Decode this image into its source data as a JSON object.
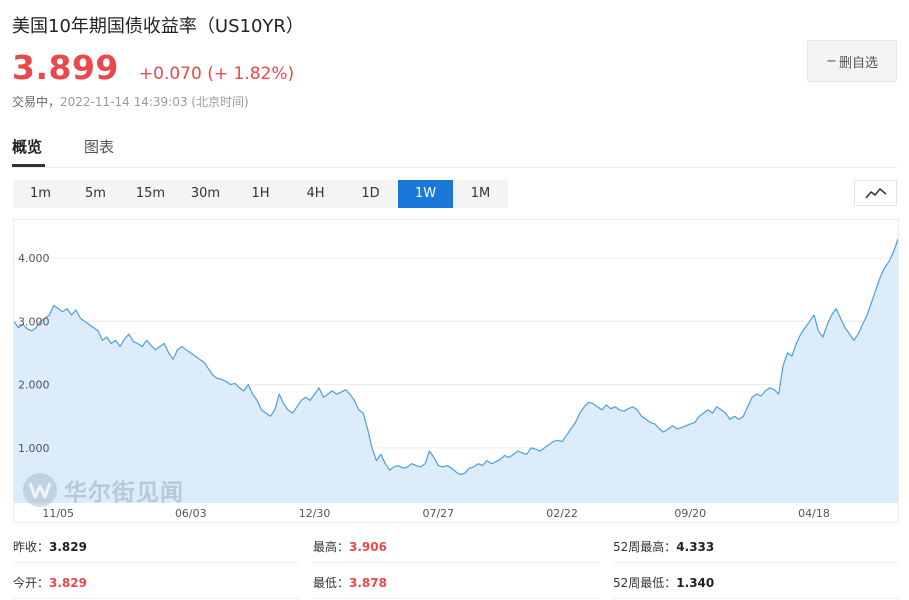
{
  "header": {
    "title": "美国10年期国债收益率（US10YR）",
    "price": "3.899",
    "change": "+0.070 (+ 1.82%)",
    "status_label": "交易中，",
    "timestamp": "2022-11-14 14:39:03",
    "timezone": "(北京时间)",
    "remove_button": "删自选",
    "remove_button_prefix": "−"
  },
  "tabs": [
    {
      "label": "概览",
      "active": true
    },
    {
      "label": "图表",
      "active": false
    }
  ],
  "periods": [
    {
      "label": "1m"
    },
    {
      "label": "5m"
    },
    {
      "label": "15m"
    },
    {
      "label": "30m"
    },
    {
      "label": "1H"
    },
    {
      "label": "4H"
    },
    {
      "label": "1D"
    },
    {
      "label": "1W",
      "active": true
    },
    {
      "label": "1M"
    }
  ],
  "watermark": {
    "text": "华尔街见闻",
    "logo_letter": "W"
  },
  "stats": {
    "prev_close_label": "昨收：",
    "prev_close": "3.829",
    "high_label": "最高：",
    "high": "3.906",
    "wk52_high_label": "52周最高：",
    "wk52_high": "4.333",
    "open_label": "今开：",
    "open": "3.829",
    "low_label": "最低：",
    "low": "3.878",
    "wk52_low_label": "52周最低：",
    "wk52_low": "1.340"
  },
  "colors": {
    "up": "#e9494b",
    "accent": "#1a78d8",
    "line": "#4d9fe0",
    "fill": "#dcecfb"
  },
  "chart_data": {
    "type": "area",
    "title": "",
    "xlabel": "",
    "ylabel": "",
    "ylim": [
      0.13,
      4.6
    ],
    "yticks": [
      1.0,
      2.0,
      3.0,
      4.0
    ],
    "ytick_labels": [
      "1.000",
      "2.000",
      "3.000",
      "4.000"
    ],
    "xtick_labels": [
      "11/05",
      "06/03",
      "12/30",
      "07/27",
      "02/22",
      "09/20",
      "04/18"
    ],
    "xtick_index": [
      10,
      40,
      68,
      96,
      124,
      153,
      181
    ],
    "grid": true,
    "values": [
      3.0,
      2.9,
      2.95,
      2.88,
      2.85,
      2.9,
      3.0,
      3.05,
      3.1,
      3.25,
      3.2,
      3.15,
      3.2,
      3.1,
      3.18,
      3.05,
      3.0,
      2.95,
      2.9,
      2.85,
      2.7,
      2.75,
      2.65,
      2.7,
      2.6,
      2.72,
      2.8,
      2.68,
      2.65,
      2.6,
      2.7,
      2.62,
      2.55,
      2.6,
      2.65,
      2.5,
      2.4,
      2.55,
      2.6,
      2.55,
      2.5,
      2.45,
      2.4,
      2.35,
      2.25,
      2.15,
      2.1,
      2.08,
      2.05,
      2.0,
      2.02,
      1.95,
      1.9,
      2.0,
      1.85,
      1.75,
      1.6,
      1.55,
      1.5,
      1.6,
      1.85,
      1.7,
      1.6,
      1.55,
      1.65,
      1.75,
      1.8,
      1.75,
      1.85,
      1.95,
      1.8,
      1.85,
      1.9,
      1.85,
      1.88,
      1.92,
      1.85,
      1.75,
      1.6,
      1.55,
      1.3,
      1.0,
      0.8,
      0.9,
      0.75,
      0.65,
      0.7,
      0.72,
      0.68,
      0.7,
      0.75,
      0.72,
      0.7,
      0.75,
      0.95,
      0.85,
      0.72,
      0.7,
      0.72,
      0.68,
      0.62,
      0.58,
      0.6,
      0.68,
      0.7,
      0.75,
      0.72,
      0.8,
      0.75,
      0.78,
      0.82,
      0.88,
      0.85,
      0.9,
      0.95,
      0.92,
      0.9,
      1.0,
      0.98,
      0.95,
      1.0,
      1.05,
      1.1,
      1.12,
      1.1,
      1.2,
      1.3,
      1.4,
      1.55,
      1.65,
      1.72,
      1.7,
      1.65,
      1.6,
      1.68,
      1.62,
      1.65,
      1.6,
      1.58,
      1.62,
      1.65,
      1.6,
      1.5,
      1.45,
      1.4,
      1.38,
      1.3,
      1.25,
      1.3,
      1.35,
      1.3,
      1.32,
      1.35,
      1.38,
      1.4,
      1.5,
      1.55,
      1.6,
      1.55,
      1.65,
      1.6,
      1.55,
      1.45,
      1.5,
      1.45,
      1.5,
      1.65,
      1.8,
      1.85,
      1.82,
      1.9,
      1.95,
      1.92,
      1.85,
      2.3,
      2.5,
      2.45,
      2.65,
      2.8,
      2.9,
      3.0,
      3.1,
      2.85,
      2.75,
      2.95,
      3.1,
      3.2,
      3.05,
      2.9,
      2.8,
      2.7,
      2.8,
      2.95,
      3.1,
      3.3,
      3.5,
      3.7,
      3.85,
      3.95,
      4.1,
      4.3
    ]
  }
}
